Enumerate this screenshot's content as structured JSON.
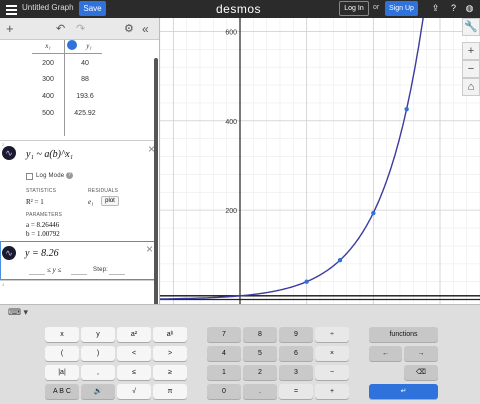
{
  "header": {
    "graph_title": "Untitled Graph",
    "save_label": "Save",
    "logo": "desmos",
    "login_label": "Log In",
    "or_text": "or",
    "signup_label": "Sign Up"
  },
  "table": {
    "col_x_header": "x₁",
    "col_y_header": "y₁",
    "rows": [
      [
        "200",
        "40"
      ],
      [
        "300",
        "88"
      ],
      [
        "400",
        "193.6"
      ],
      [
        "500",
        "425.92"
      ]
    ]
  },
  "regression": {
    "expression": "y₁ ~ a(b)^x₁",
    "log_mode_label": "Log Mode",
    "statistics_label": "STATISTICS",
    "residuals_label": "RESIDUALS",
    "r_squared": "R² = 1",
    "residual_symbol": "e₁",
    "plot_label": "plot",
    "parameters_label": "PARAMETERS",
    "param_a": "a = 8.26446",
    "param_b": "b = 1.00792"
  },
  "active_expression": {
    "expression": "y = 8.26",
    "domain_text": "≤ y ≤",
    "step_label": "Step:"
  },
  "graph": {
    "x_ticks": [
      "-200",
      "0",
      "200",
      "400",
      "600"
    ],
    "y_ticks": [
      "200",
      "400",
      "600"
    ],
    "curve_color": "#3b3b9e",
    "points": [
      [
        200,
        40
      ],
      [
        300,
        88
      ],
      [
        400,
        193.6
      ],
      [
        500,
        425.92
      ]
    ]
  },
  "keypad": {
    "left_keys": [
      [
        "x",
        "y",
        "a²",
        "aᵇ"
      ],
      [
        "(",
        ")",
        "<",
        ">"
      ],
      [
        "|a|",
        ",",
        "≤",
        "≥"
      ],
      [
        "A B C",
        "🔊",
        "√",
        "π"
      ]
    ],
    "num_keys": [
      [
        "7",
        "8",
        "9",
        "÷"
      ],
      [
        "4",
        "5",
        "6",
        "×"
      ],
      [
        "1",
        "2",
        "3",
        "−"
      ],
      [
        "0",
        ".",
        "=",
        "+"
      ]
    ],
    "functions_label": "functions"
  },
  "colors": {
    "accent": "#2f72dc",
    "curve": "#3b3b9e"
  }
}
